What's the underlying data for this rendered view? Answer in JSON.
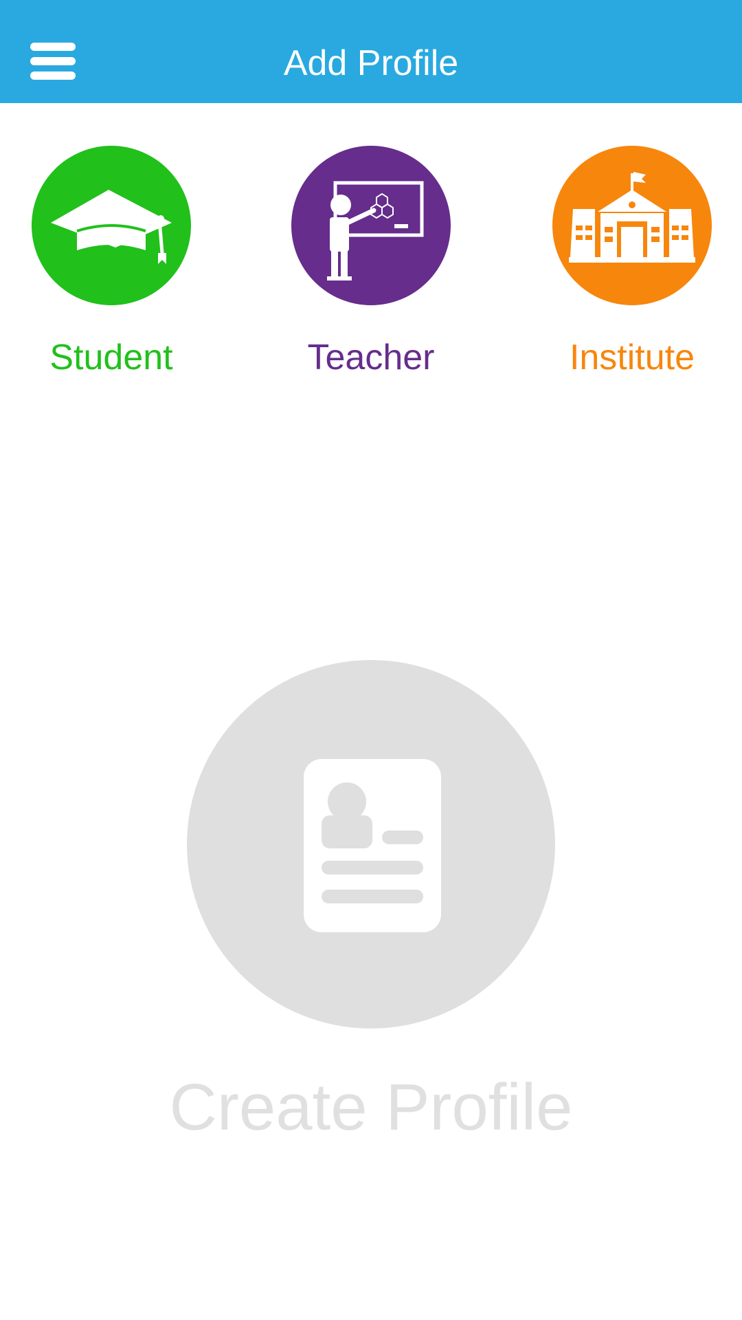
{
  "header": {
    "title": "Add Profile",
    "background_color": "#29a9e0",
    "menu_icon": "hamburger-menu-icon"
  },
  "profile_types": [
    {
      "label": "Student",
      "color": "#21c01b",
      "icon": "graduation-cap-icon"
    },
    {
      "label": "Teacher",
      "color": "#662d8c",
      "icon": "teacher-board-icon"
    },
    {
      "label": "Institute",
      "color": "#f7860d",
      "icon": "school-building-icon"
    }
  ],
  "create_profile": {
    "label": "Create Profile",
    "circle_color": "#dfdfdf",
    "text_color": "#e0e0e0",
    "icon": "profile-card-icon"
  }
}
